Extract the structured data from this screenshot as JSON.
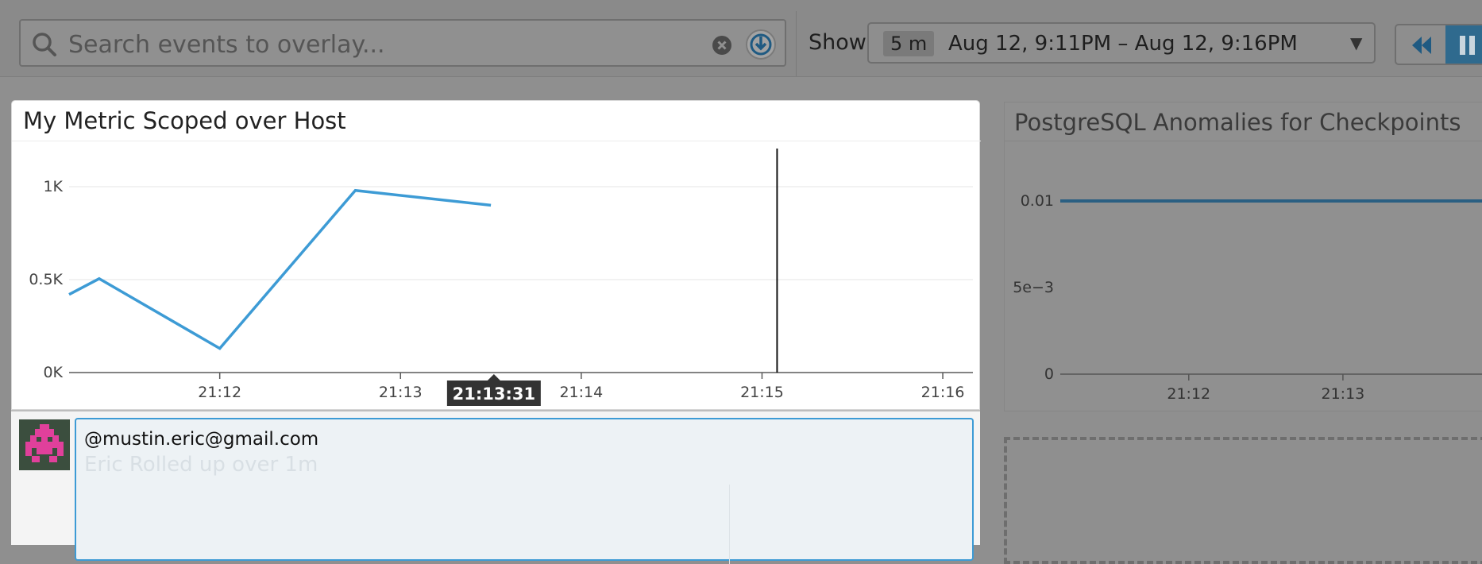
{
  "search": {
    "placeholder": "Search events to overlay..."
  },
  "timeframe": {
    "show_label": "Show",
    "badge": "5 m",
    "range": "Aug 12, 9:11PM – Aug 12, 9:16PM"
  },
  "colors": {
    "series": "#3d9bd5",
    "accent": "#2f6a8e"
  },
  "widgets": [
    {
      "title": "My Metric Scoped over Host",
      "tooltip": "21:13:31",
      "chart_data": {
        "type": "line",
        "x": [
          "21:11:10",
          "21:11:20",
          "21:12:00",
          "21:12:45",
          "21:13:30"
        ],
        "series": [
          {
            "values": [
              420,
              505,
              130,
              980,
              900
            ]
          }
        ],
        "xticks": [
          "21:12",
          "21:13",
          "21:14",
          "21:15",
          "21:16"
        ],
        "yticks": [
          "0K",
          "0.5K",
          "1K"
        ],
        "ylim": [
          0,
          1000
        ],
        "xlim": [
          "21:11:10",
          "21:16:10"
        ],
        "marker_x": "21:15:05",
        "hover_x": "21:13:31",
        "title": "My Metric Scoped over Host",
        "grid": true
      }
    },
    {
      "title": "PostgreSQL Anomalies for Checkpoints",
      "chart_data": {
        "type": "line",
        "x": [
          "21:11:10",
          "21:16:10"
        ],
        "series": [
          {
            "values": [
              0.01,
              0.01
            ]
          }
        ],
        "xticks": [
          "21:12",
          "21:13"
        ],
        "yticks": [
          "0",
          "5e−3",
          "0.01"
        ],
        "ylim": [
          0,
          0.01
        ],
        "xlim": [
          "21:11:10",
          "21:14:00"
        ],
        "title": "PostgreSQL Anomalies for Checkpoints",
        "grid": false
      }
    }
  ],
  "comment": {
    "text": "@mustin.eric@gmail.com",
    "ghost": "Eric Rolled up over 1m"
  }
}
